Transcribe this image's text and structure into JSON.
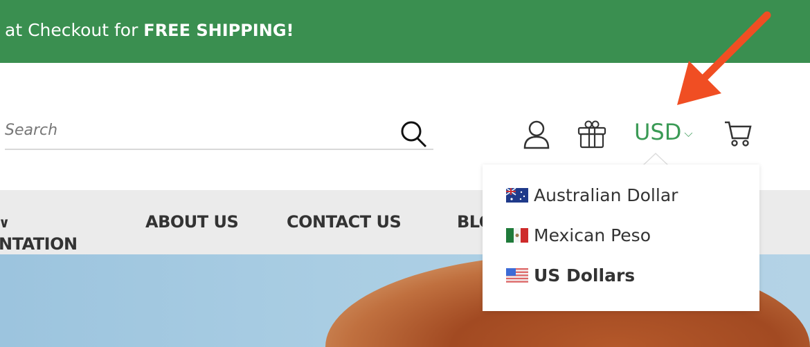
{
  "banner": {
    "text": "at Checkout for ",
    "bold": "FREE SHIPPING!",
    "color": "#3a8f50"
  },
  "search": {
    "placeholder": "Search",
    "value": "",
    "icon": "search-icon"
  },
  "header_icons": [
    "account-icon",
    "gift-icon",
    "cart-icon"
  ],
  "currency": {
    "selected": "USD",
    "color": "#3a9a55"
  },
  "nav": {
    "items": [
      {
        "label": "NTATION"
      },
      {
        "label": "ABOUT US"
      },
      {
        "label": "CONTACT US"
      },
      {
        "label": "BLOG"
      }
    ]
  },
  "currency_dropdown": {
    "options": [
      {
        "label": "Australian Dollar",
        "flag": "australia-flag-icon",
        "selected": false
      },
      {
        "label": "Mexican Peso",
        "flag": "mexico-flag-icon",
        "selected": false
      },
      {
        "label": "US Dollars",
        "flag": "us-flag-icon",
        "selected": true
      }
    ]
  },
  "annotation": {
    "color": "#f04e23"
  }
}
